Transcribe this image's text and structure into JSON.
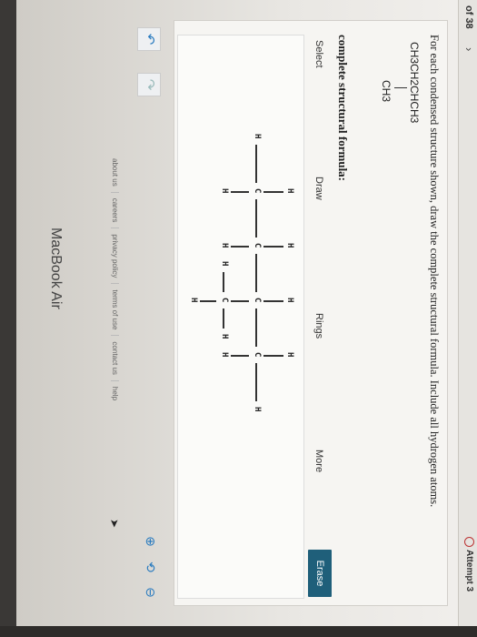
{
  "nav": {
    "page_indicator": "of 38",
    "chevron": "›",
    "attempt": "Attempt 3"
  },
  "question": {
    "prompt": "For each condensed structure shown, draw the complete structural formula. Include all hydrogen atoms.",
    "formula": "CH3CH2CHCH3",
    "branch": "CH3"
  },
  "editor": {
    "subtitle": "complete structural formula:",
    "tools": {
      "select": "Select",
      "draw": "Draw",
      "rings": "Rings",
      "more": "More",
      "erase": "Erase"
    },
    "atoms": {
      "carbon": "C",
      "hydrogen": "H"
    }
  },
  "icons": {
    "undo": "undo-icon",
    "redo": "redo-icon",
    "zoom_in": "zoom-in-icon",
    "zoom_reset": "zoom-reset-icon",
    "zoom_out": "zoom-out-icon"
  },
  "footer": {
    "links": [
      "about us",
      "careers",
      "privacy policy",
      "terms of use",
      "contact us",
      "help"
    ]
  },
  "device": {
    "brand": "MacBook Air"
  },
  "colors": {
    "accent": "#1f5f7a",
    "link": "#2a7bbf",
    "attempt_icon": "#b33"
  }
}
